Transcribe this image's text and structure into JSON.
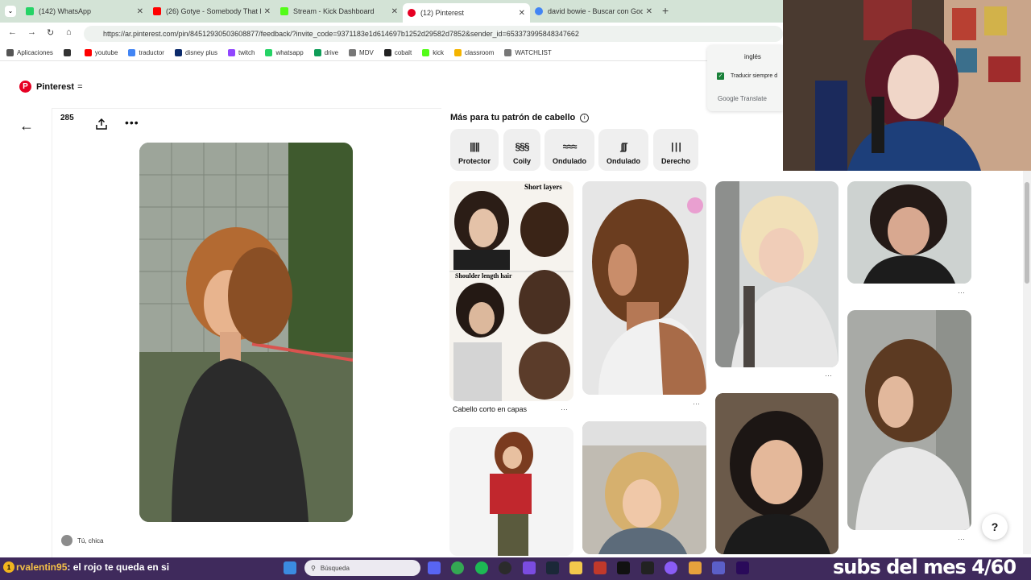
{
  "browser": {
    "tabs": [
      {
        "title": "(142) WhatsApp",
        "color": "#25d366",
        "active": false
      },
      {
        "title": "(26) Gotye - Somebody That I Used",
        "color": "#ff0000",
        "active": false
      },
      {
        "title": "Stream - Kick Dashboard",
        "color": "#53fc18",
        "active": false
      },
      {
        "title": "(12) Pinterest",
        "color": "#e60023",
        "active": true
      },
      {
        "title": "david bowie - Buscar con Google",
        "color": "#4285f4",
        "active": false
      }
    ],
    "new_tab": "+",
    "url": "https://ar.pinterest.com/pin/845129305036088​77/feedback/?invite_code=9371183e1d614697b1252d29582d7852&sender_id=653373995848347662",
    "bookmarks": [
      {
        "label": "Aplicaciones",
        "color": "#555555"
      },
      {
        "label": "youtube",
        "color": "#ff0000"
      },
      {
        "label": "traductor",
        "color": "#4285f4"
      },
      {
        "label": "disney plus",
        "color": "#0b2a6b"
      },
      {
        "label": "twitch",
        "color": "#9146ff"
      },
      {
        "label": "whatsapp",
        "color": "#25d366"
      },
      {
        "label": "drive",
        "color": "#0f9d58"
      },
      {
        "label": "MDV",
        "color": "#777777"
      },
      {
        "label": "cobalt",
        "color": "#222222"
      },
      {
        "label": "kick",
        "color": "#53fc18"
      },
      {
        "label": "classroom",
        "color": "#f4b400"
      },
      {
        "label": "WATCHLIST",
        "color": "#777777"
      }
    ]
  },
  "translate_popup": {
    "language": "inglés",
    "checkbox_label": "Traducir siempre d",
    "brand": "Google",
    "brand_suffix": "Translate"
  },
  "pinterest": {
    "brand": "Pinterest",
    "menu_glyph": "=",
    "save_count": "285",
    "user_caption": "Tú, chica",
    "related_title": "Más para tu patrón de cabello",
    "chips": [
      {
        "label": "Protector",
        "icon": "|||||"
      },
      {
        "label": "Coily",
        "icon": "§§§"
      },
      {
        "label": "Ondulado",
        "icon": "≈≈≈"
      },
      {
        "label": "Ondulado",
        "icon": "∫∫∫"
      },
      {
        "label": "Derecho",
        "icon": "| | |"
      }
    ],
    "pins": [
      {
        "caption": "Cabello corto en capas",
        "overlay_top": "Short layers",
        "overlay_mid": "Shoulder length hair"
      }
    ]
  },
  "taskbar": {
    "chat_user": "rvalentin95",
    "chat_message": ": el rojo te queda en si",
    "search_placeholder": "Búsqueda",
    "subs_text": "subs del mes 4/60"
  },
  "help_label": "?"
}
